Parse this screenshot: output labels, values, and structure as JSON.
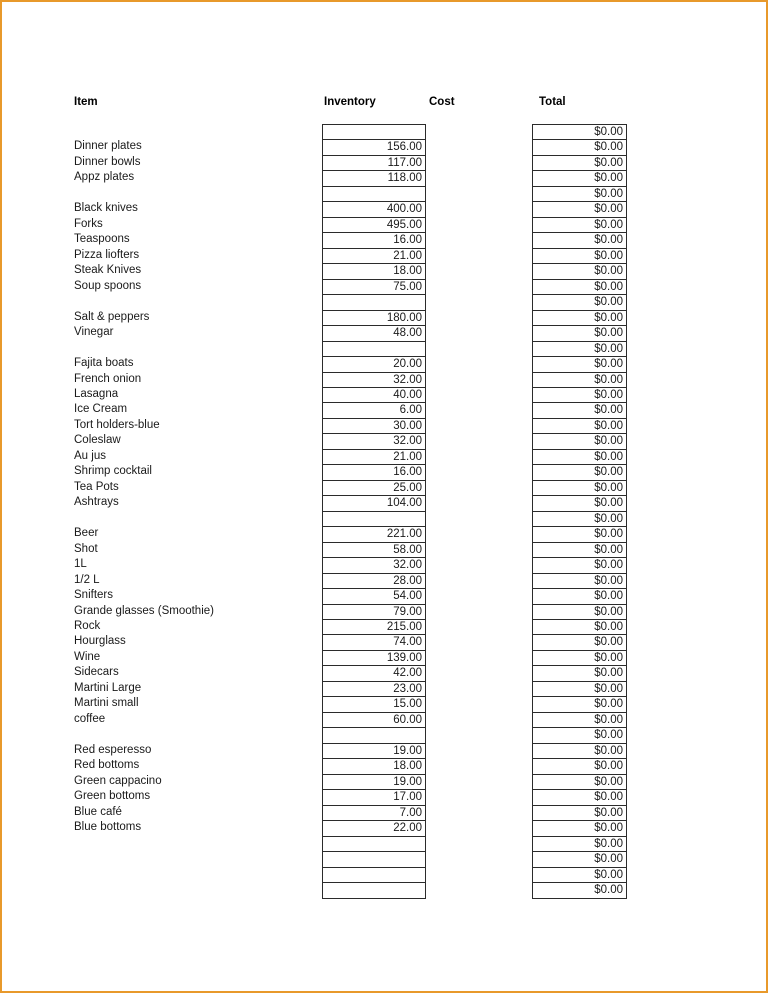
{
  "document": {
    "border_color": "#e8992b",
    "background": "#ffffff"
  },
  "headers": {
    "item": "Item",
    "inventory": "Inventory",
    "cost": "Cost",
    "total": "Total"
  },
  "table": {
    "currency_zero": "$0.00",
    "rows": [
      {
        "item": "",
        "inventory": "",
        "total": "$0.00"
      },
      {
        "item": "Dinner plates",
        "inventory": "156.00",
        "total": "$0.00"
      },
      {
        "item": "Dinner bowls",
        "inventory": "117.00",
        "total": "$0.00"
      },
      {
        "item": "Appz plates",
        "inventory": "118.00",
        "total": "$0.00"
      },
      {
        "item": "",
        "inventory": "",
        "total": "$0.00"
      },
      {
        "item": "Black knives",
        "inventory": "400.00",
        "total": "$0.00"
      },
      {
        "item": "Forks",
        "inventory": "495.00",
        "total": "$0.00"
      },
      {
        "item": "Teaspoons",
        "inventory": "16.00",
        "total": "$0.00"
      },
      {
        "item": "Pizza liofters",
        "inventory": "21.00",
        "total": "$0.00"
      },
      {
        "item": "Steak Knives",
        "inventory": "18.00",
        "total": "$0.00"
      },
      {
        "item": "Soup spoons",
        "inventory": "75.00",
        "total": "$0.00"
      },
      {
        "item": "",
        "inventory": "",
        "total": "$0.00"
      },
      {
        "item": "Salt & peppers",
        "inventory": "180.00",
        "total": "$0.00"
      },
      {
        "item": "Vinegar",
        "inventory": "48.00",
        "total": "$0.00"
      },
      {
        "item": "",
        "inventory": "",
        "total": "$0.00"
      },
      {
        "item": "Fajita boats",
        "inventory": "20.00",
        "total": "$0.00"
      },
      {
        "item": "French onion",
        "inventory": "32.00",
        "total": "$0.00"
      },
      {
        "item": "Lasagna",
        "inventory": "40.00",
        "total": "$0.00"
      },
      {
        "item": "Ice Cream",
        "inventory": "6.00",
        "total": "$0.00"
      },
      {
        "item": "Tort holders-blue",
        "inventory": "30.00",
        "total": "$0.00"
      },
      {
        "item": "Coleslaw",
        "inventory": "32.00",
        "total": "$0.00"
      },
      {
        "item": "Au jus",
        "inventory": "21.00",
        "total": "$0.00"
      },
      {
        "item": "Shrimp cocktail",
        "inventory": "16.00",
        "total": "$0.00"
      },
      {
        "item": "Tea Pots",
        "inventory": "25.00",
        "total": "$0.00"
      },
      {
        "item": "Ashtrays",
        "inventory": "104.00",
        "total": "$0.00"
      },
      {
        "item": "",
        "inventory": "",
        "total": "$0.00"
      },
      {
        "item": "Beer",
        "inventory": "221.00",
        "total": "$0.00"
      },
      {
        "item": "Shot",
        "inventory": "58.00",
        "total": "$0.00"
      },
      {
        "item": "1L",
        "inventory": "32.00",
        "total": "$0.00"
      },
      {
        "item": "1/2 L",
        "inventory": "28.00",
        "total": "$0.00"
      },
      {
        "item": "Snifters",
        "inventory": "54.00",
        "total": "$0.00"
      },
      {
        "item": "Grande glasses (Smoothie)",
        "inventory": "79.00",
        "total": "$0.00"
      },
      {
        "item": "Rock",
        "inventory": "215.00",
        "total": "$0.00"
      },
      {
        "item": "Hourglass",
        "inventory": "74.00",
        "total": "$0.00"
      },
      {
        "item": "Wine",
        "inventory": "139.00",
        "total": "$0.00"
      },
      {
        "item": "Sidecars",
        "inventory": "42.00",
        "total": "$0.00"
      },
      {
        "item": "Martini Large",
        "inventory": "23.00",
        "total": "$0.00"
      },
      {
        "item": "Martini small",
        "inventory": "15.00",
        "total": "$0.00"
      },
      {
        "item": "coffee",
        "inventory": "60.00",
        "total": "$0.00"
      },
      {
        "item": "",
        "inventory": "",
        "total": "$0.00"
      },
      {
        "item": "Red esperesso",
        "inventory": "19.00",
        "total": "$0.00"
      },
      {
        "item": "Red bottoms",
        "inventory": "18.00",
        "total": "$0.00"
      },
      {
        "item": "Green cappacino",
        "inventory": "19.00",
        "total": "$0.00"
      },
      {
        "item": "Green bottoms",
        "inventory": "17.00",
        "total": "$0.00"
      },
      {
        "item": "Blue café",
        "inventory": "7.00",
        "total": "$0.00"
      },
      {
        "item": "Blue bottoms",
        "inventory": "22.00",
        "total": "$0.00"
      },
      {
        "item": "",
        "inventory": "",
        "total": "$0.00"
      },
      {
        "item": "",
        "inventory": "",
        "total": "$0.00"
      },
      {
        "item": "",
        "inventory": "",
        "total": "$0.00"
      },
      {
        "item": "",
        "inventory": "",
        "total": "$0.00"
      }
    ]
  }
}
